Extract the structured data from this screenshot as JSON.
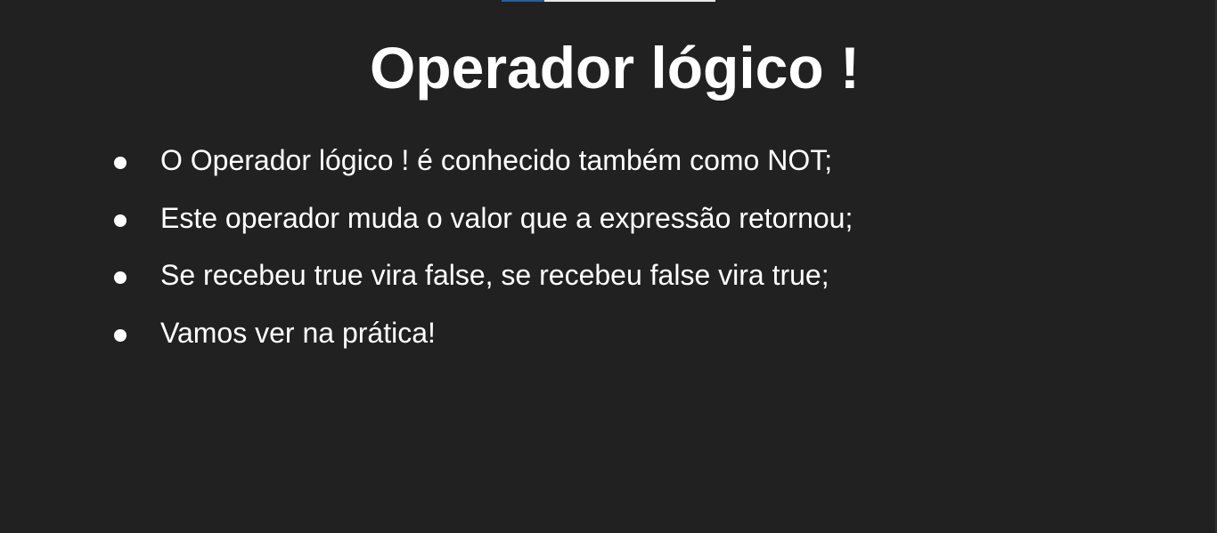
{
  "slide": {
    "title": "Operador lógico !",
    "bullets": [
      "O Operador lógico ! é conhecido também como NOT;",
      "Este operador muda o valor que a expressão retornou;",
      "Se recebeu true vira false, se recebeu false vira true;",
      "Vamos ver na prática!"
    ]
  },
  "colors": {
    "background": "#212121",
    "text": "#ffffff",
    "progress_accent": "#1f5fa8"
  }
}
